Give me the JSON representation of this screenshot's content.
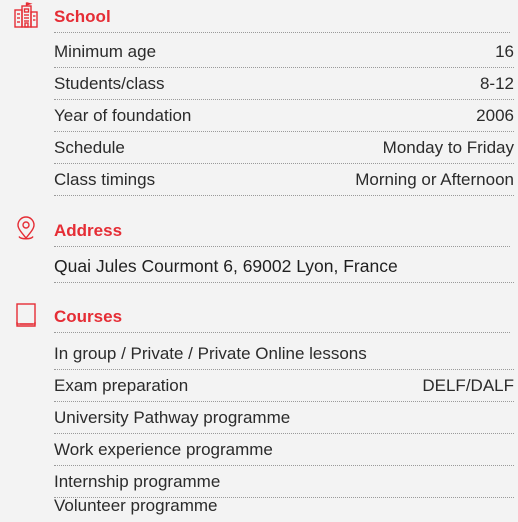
{
  "school": {
    "title": "School",
    "icon": "school-building-icon",
    "rows": [
      {
        "label": "Minimum age",
        "value": "16"
      },
      {
        "label": "Students/class",
        "value": "8-12"
      },
      {
        "label": "Year of foundation",
        "value": "2006"
      },
      {
        "label": "Schedule",
        "value": "Monday to Friday"
      },
      {
        "label": "Class timings",
        "value": "Morning or Afternoon"
      }
    ]
  },
  "address": {
    "title": "Address",
    "icon": "location-pin-icon",
    "text": "Quai Jules Courmont 6, 69002 Lyon, France"
  },
  "courses": {
    "title": "Courses",
    "icon": "book-icon",
    "rows": [
      {
        "label": "In group / Private / Private Online lessons",
        "value": ""
      },
      {
        "label": "Exam preparation",
        "value": "DELF/DALF"
      },
      {
        "label": "University Pathway programme",
        "value": ""
      },
      {
        "label": "Work experience programme",
        "value": ""
      },
      {
        "label": "Internship programme",
        "value": ""
      },
      {
        "label": "Volunteer programme",
        "value": ""
      }
    ]
  },
  "colors": {
    "accent": "#e52d35",
    "text": "#2b2b2b",
    "background": "#f3f3f3"
  }
}
